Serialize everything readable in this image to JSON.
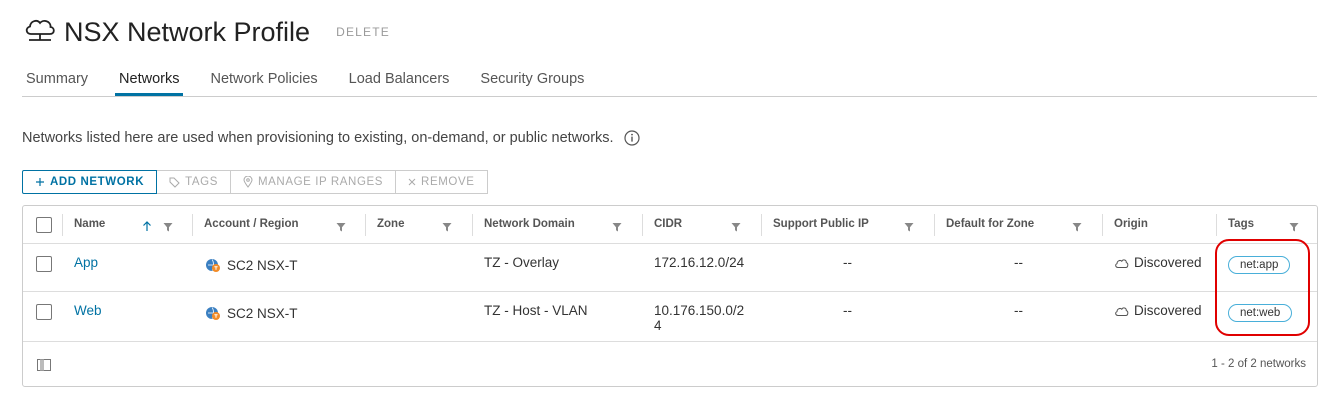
{
  "header": {
    "title": "NSX Network Profile",
    "delete_label": "DELETE",
    "logo_icon": "cloud-network-icon"
  },
  "tabs": [
    {
      "label": "Summary",
      "active": false
    },
    {
      "label": "Networks",
      "active": true
    },
    {
      "label": "Network Policies",
      "active": false
    },
    {
      "label": "Load Balancers",
      "active": false
    },
    {
      "label": "Security Groups",
      "active": false
    }
  ],
  "description": "Networks listed here are used when provisioning to existing, on-demand, or public networks.",
  "toolbar": {
    "add_network": "ADD NETWORK",
    "tags": "TAGS",
    "manage_ip_ranges": "MANAGE IP RANGES",
    "remove": "REMOVE"
  },
  "table": {
    "columns": [
      "Name",
      "Account / Region",
      "Zone",
      "Network Domain",
      "CIDR",
      "Support Public IP",
      "Default for Zone",
      "Origin",
      "Tags"
    ],
    "rows": [
      {
        "name": "App",
        "account": "SC2 NSX-T",
        "zone": "",
        "domain": "TZ - Overlay",
        "cidr": "172.16.12.0/24",
        "public_ip": "--",
        "default_zone": "--",
        "origin": "Discovered",
        "tag": "net:app"
      },
      {
        "name": "Web",
        "account": "SC2 NSX-T",
        "zone": "",
        "domain": "TZ - Host - VLAN",
        "cidr": "10.176.150.0/24",
        "public_ip": "--",
        "default_zone": "--",
        "origin": "Discovered",
        "tag": "net:web"
      }
    ],
    "footer_count": "1 - 2 of 2 networks"
  },
  "colors": {
    "accent": "#0072a3",
    "highlight": "#e00000",
    "tag_border": "#49afd9"
  }
}
